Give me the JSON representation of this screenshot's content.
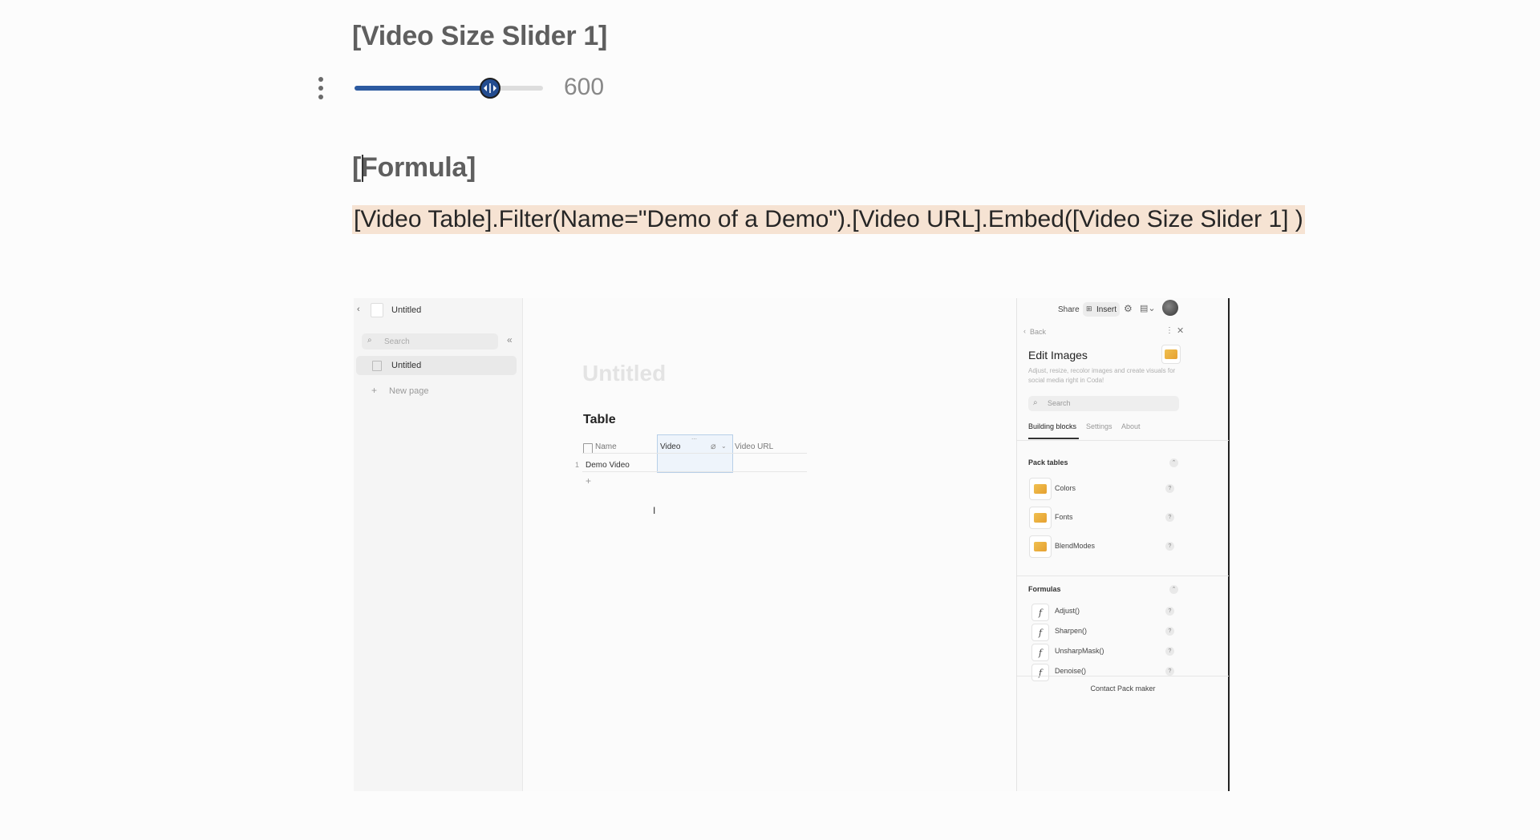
{
  "slider_block": {
    "title": "[Video Size Slider 1]",
    "value": "600",
    "fraction": 0.72
  },
  "formula_block": {
    "title": "[Formula]",
    "expression": "[Video Table].Filter(Name=\"Demo of a Demo\").[Video URL].Embed([Video Size Slider 1] )"
  },
  "embed": {
    "left_sidebar": {
      "doc_title": "Untitled",
      "search_placeholder": "Search",
      "pages": [
        "Untitled"
      ],
      "new_page": "New page"
    },
    "main": {
      "page_title": "Untitled",
      "table_title": "Table",
      "columns": [
        "Name",
        "Video",
        "Video URL"
      ],
      "rows": [
        {
          "num": "1",
          "name": "Demo Video"
        }
      ],
      "add_row": "+"
    },
    "right_panel": {
      "toolbar": {
        "share": "Share",
        "insert": "Insert"
      },
      "back": "Back",
      "title": "Edit Images",
      "description": "Adjust, resize, recolor images and create visuals for social media right in Coda!",
      "search_placeholder": "Search",
      "tabs": [
        "Building blocks",
        "Settings",
        "About"
      ],
      "pack_tables_heading": "Pack tables",
      "pack_tables": [
        "Colors",
        "Fonts",
        "BlendModes"
      ],
      "formulas_heading": "Formulas",
      "formulas": [
        "Adjust()",
        "Sharpen()",
        "UnsharpMask()",
        "Denoise()"
      ],
      "contact": "Contact Pack maker"
    }
  },
  "colors": {
    "slider_fill": "#2c5aa0",
    "formula_bg": "#f6e3d3"
  }
}
